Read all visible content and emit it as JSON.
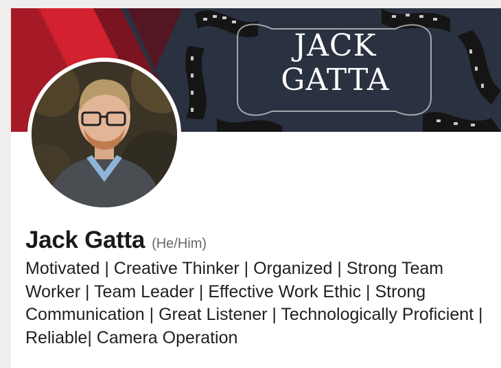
{
  "banner": {
    "title_line1": "JACK",
    "title_line2": "GATTA",
    "colors": {
      "background": "#2a3140",
      "chevron_red": "#d3212f",
      "chevron_dark_red": "#7a1420",
      "film": "#111111"
    }
  },
  "profile": {
    "name": "Jack Gatta",
    "pronouns": "(He/Him)",
    "headline": "Motivated | Creative Thinker | Organized | Strong Team Worker | Team Leader | Effective Work Ethic | Strong Communication | Great Listener | Technologically Proficient | Reliable| Camera Operation"
  }
}
